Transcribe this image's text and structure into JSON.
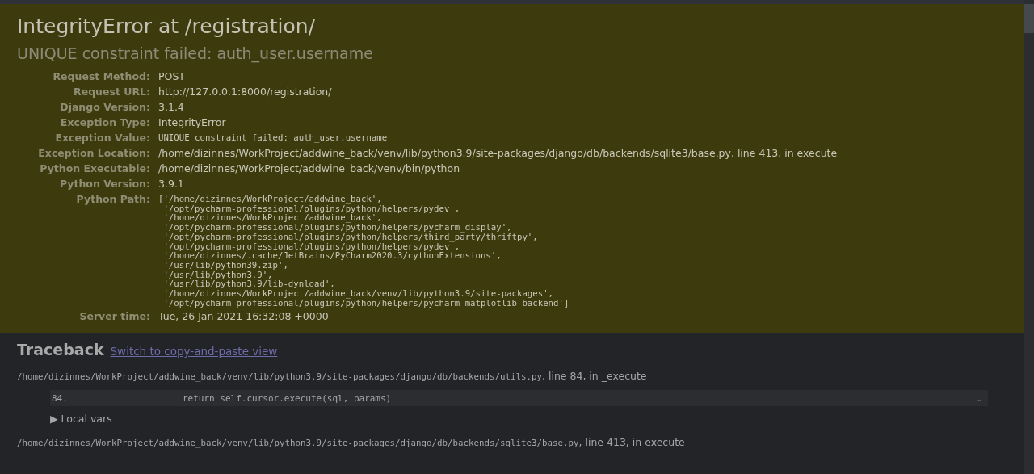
{
  "summary": {
    "title": "IntegrityError at /registration/",
    "subtitle": "UNIQUE constraint failed: auth_user.username",
    "meta": [
      {
        "label": "Request Method:",
        "value": "POST",
        "kind": "text"
      },
      {
        "label": "Request URL:",
        "value": "http://127.0.0.1:8000/registration/",
        "kind": "text"
      },
      {
        "label": "Django Version:",
        "value": "3.1.4",
        "kind": "text"
      },
      {
        "label": "Exception Type:",
        "value": "IntegrityError",
        "kind": "text"
      },
      {
        "label": "Exception Value:",
        "value": "UNIQUE constraint failed: auth_user.username",
        "kind": "code"
      },
      {
        "label": "Exception Location:",
        "value": "/home/dizinnes/WorkProject/addwine_back/venv/lib/python3.9/site-packages/django/db/backends/sqlite3/base.py, line 413, in execute",
        "kind": "text"
      },
      {
        "label": "Python Executable:",
        "value": "/home/dizinnes/WorkProject/addwine_back/venv/bin/python",
        "kind": "text"
      },
      {
        "label": "Python Version:",
        "value": "3.9.1",
        "kind": "text"
      },
      {
        "label": "Python Path:",
        "kind": "list",
        "lines": [
          "['/home/dizinnes/WorkProject/addwine_back',",
          " '/opt/pycharm-professional/plugins/python/helpers/pydev',",
          " '/home/dizinnes/WorkProject/addwine_back',",
          " '/opt/pycharm-professional/plugins/python/helpers/pycharm_display',",
          " '/opt/pycharm-professional/plugins/python/helpers/third_party/thriftpy',",
          " '/opt/pycharm-professional/plugins/python/helpers/pydev',",
          " '/home/dizinnes/.cache/JetBrains/PyCharm2020.3/cythonExtensions',",
          " '/usr/lib/python39.zip',",
          " '/usr/lib/python3.9',",
          " '/usr/lib/python3.9/lib-dynload',",
          " '/home/dizinnes/WorkProject/addwine_back/venv/lib/python3.9/site-packages',",
          " '/opt/pycharm-professional/plugins/python/helpers/pycharm_matplotlib_backend']"
        ]
      },
      {
        "label": "Server time:",
        "value": "Tue, 26 Jan 2021 16:32:08 +0000",
        "kind": "text"
      }
    ]
  },
  "traceback": {
    "title": "Traceback",
    "switch_link": "Switch to copy-and-paste view",
    "frames": [
      {
        "file": "/home/dizinnes/WorkProject/addwine_back/venv/lib/python3.9/site-packages/django/db/backends/utils.py",
        "location": ", line 84, in _execute",
        "context": [
          {
            "lineno": "84.",
            "code": "                return self.cursor.execute(sql, params)",
            "more": "…"
          }
        ],
        "local_vars": "▶ Local vars"
      },
      {
        "file": "/home/dizinnes/WorkProject/addwine_back/venv/lib/python3.9/site-packages/django/db/backends/sqlite3/base.py",
        "location": ", line 413, in execute"
      }
    ]
  }
}
